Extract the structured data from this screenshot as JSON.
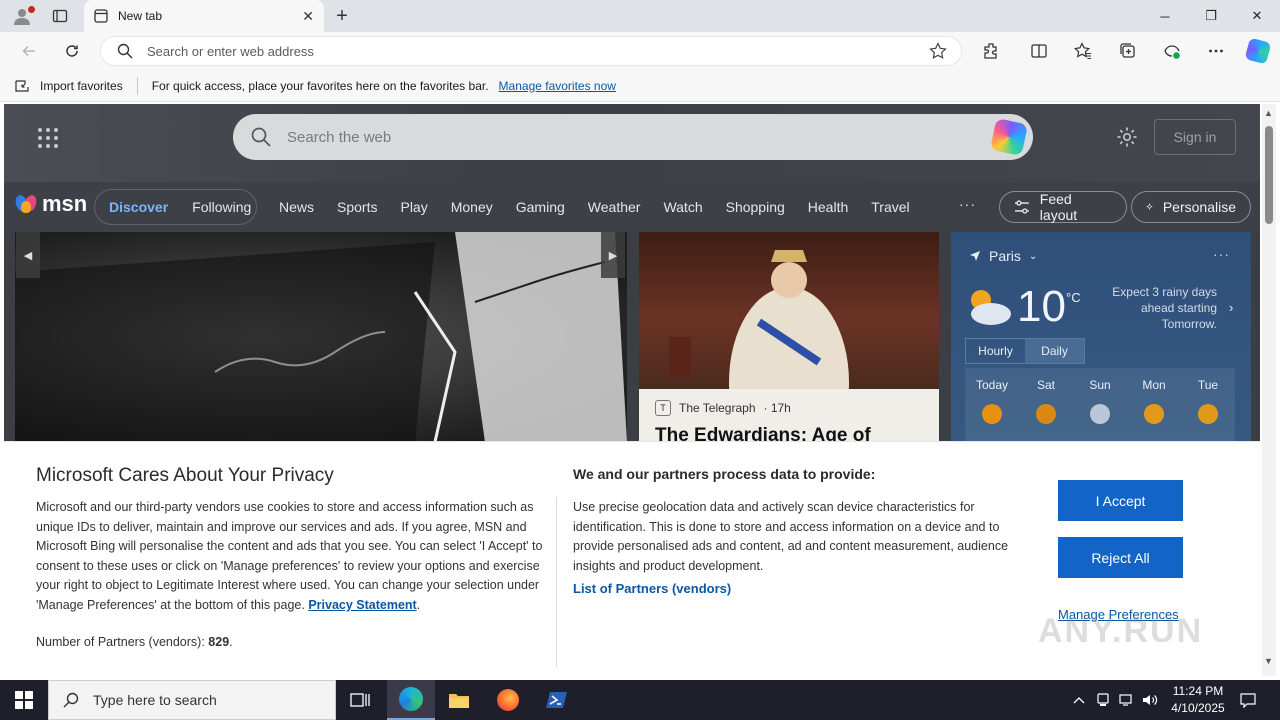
{
  "browser": {
    "tab_title": "New tab",
    "address_placeholder": "Search or enter web address",
    "favbar": {
      "import_label": "Import favorites",
      "message": "For quick access, place your favorites here on the favorites bar.",
      "manage_link": "Manage favorites now"
    }
  },
  "msn": {
    "search_placeholder": "Search the web",
    "signin_label": "Sign in",
    "logo_text": "msn",
    "pill_tabs": [
      "Discover",
      "Following"
    ],
    "nav_items": [
      "News",
      "Sports",
      "Play",
      "Money",
      "Gaming",
      "Weather",
      "Watch",
      "Shopping",
      "Health",
      "Travel"
    ],
    "nav_more": "···",
    "feed_layout_label": "Feed layout",
    "personalise_label": "Personalise",
    "card2": {
      "source": "The Telegraph",
      "age": "· 17h",
      "headline": "The Edwardians: Age of"
    },
    "weather": {
      "location": "Paris",
      "temp": "10",
      "unit": "°C",
      "forecast": "Expect 3 rainy days ahead starting Tomorrow.",
      "tabs": [
        "Hourly",
        "Daily"
      ],
      "days": [
        "Today",
        "Sat",
        "Sun",
        "Mon",
        "Tue"
      ]
    }
  },
  "privacy": {
    "title": "Microsoft Cares About Your Privacy",
    "body": "Microsoft and our third-party vendors use cookies to store and access information such as unique IDs to deliver, maintain and improve our services and ads. If you agree, MSN and Microsoft Bing will personalise the content and ads that you see. You can select 'I Accept' to consent to these uses or click on 'Manage preferences' to review your options and exercise your right to object to Legitimate Interest where used.  You can change your selection under 'Manage Preferences' at the bottom of this page.",
    "privacy_link": "Privacy Statement",
    "partners_label": "Number of Partners (vendors):",
    "partners_count": "829",
    "heading2": "We and our partners process data to provide:",
    "body2": "Use precise geolocation data and actively scan device characteristics for identification. This is done to store and access information on a device and to provide personalised ads and content, ad and content measurement, audience insights and product development.",
    "partners_link": "List of Partners (vendors)",
    "accept_label": "I Accept",
    "reject_label": "Reject All",
    "manage_label": "Manage Preferences"
  },
  "watermark": "ANY.RUN",
  "taskbar": {
    "search_placeholder": "Type here to search",
    "time": "11:24 PM",
    "date": "4/10/2025"
  },
  "colors": {
    "accent": "#1265c6",
    "link": "#0b57a4",
    "msn_bg": "#3d4147"
  }
}
